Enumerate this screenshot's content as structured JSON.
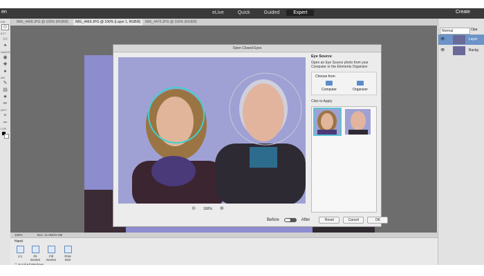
{
  "topbar": {
    "open_label": "en",
    "modes": [
      "eLive",
      "Quick",
      "Guided",
      "Expert"
    ],
    "create_label": "Create"
  },
  "doc_tabs": [
    "IMG_4468.JPG @ 100% (RGB/8)",
    "IMG_4469.JPG @ 100% (Layer 1, RGB/8)",
    "IMG_4470.JPG @ 100% (RGB/8)"
  ],
  "toolbar": {
    "groups": [
      "EW",
      "ECT",
      "HANCE",
      "AW",
      "DIFY",
      "LOR"
    ]
  },
  "dialog": {
    "title": "Open Closed Eyes",
    "zoom": "100%",
    "eye_source": {
      "heading": "Eye Source",
      "description": "Open an Eye Source photo from your Computer or the Elements Organizer",
      "choose_label": "Choose from",
      "sources": [
        "Computer",
        "Organizer"
      ],
      "apply_label": "Click to Apply:"
    },
    "before_label": "Before",
    "after_label": "After",
    "buttons": {
      "reset": "Reset",
      "cancel": "Cancel",
      "ok": "OK"
    }
  },
  "layers": {
    "blend_mode": "Normal",
    "opacity_label": "Opa",
    "rows": [
      "Layer",
      "Backg"
    ]
  },
  "status": {
    "zoom": "100%",
    "doc": "Doc: 11.0M/22.0M"
  },
  "tool_options": {
    "title": "Hand",
    "buttons": [
      "1:1",
      "Fit Screen",
      "Fill Screen",
      "Print Size"
    ],
    "scroll_all": "Scroll All Windows"
  }
}
